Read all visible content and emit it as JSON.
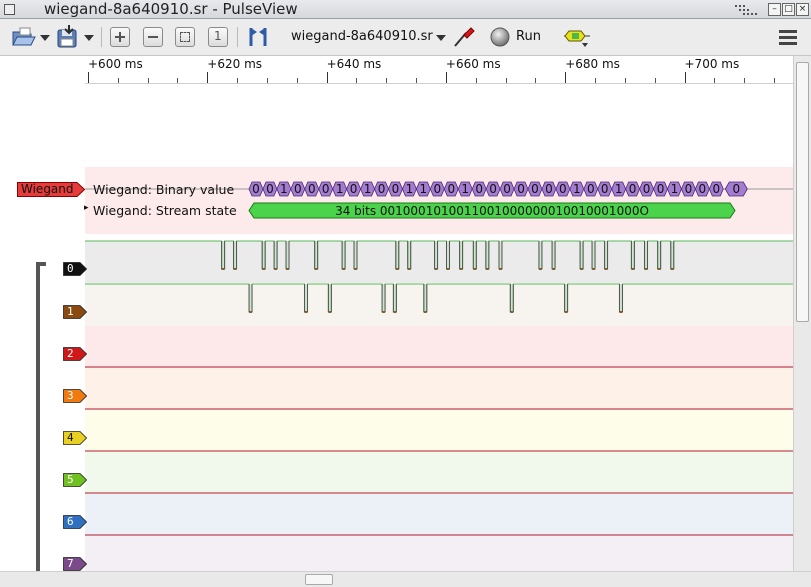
{
  "window": {
    "title": "wiegand-8a640910.sr - PulseView"
  },
  "toolbar": {
    "open_icon": "folder-open-icon",
    "save_icon": "save-icon",
    "zoom_in_icon": "zoom-in-icon",
    "zoom_out_icon": "zoom-out-icon",
    "zoom_fit_icon": "zoom-fit-icon",
    "zoom_one_icon": "zoom-one-to-one-icon",
    "cursor_icon": "cursor-icon",
    "device_name": "wiegand-8a640910.sr",
    "probe_icon": "probe-icon",
    "run_label": "Run",
    "decoder_icon": "add-decoder-icon",
    "menu_icon": "menu-icon"
  },
  "ruler": {
    "ticks": [
      {
        "label": "+600 ms",
        "ms": 600
      },
      {
        "label": "+620 ms",
        "ms": 620
      },
      {
        "label": "+640 ms",
        "ms": 640
      },
      {
        "label": "+660 ms",
        "ms": 660
      },
      {
        "label": "+680 ms",
        "ms": 680
      },
      {
        "label": "+700 ms",
        "ms": 700
      }
    ]
  },
  "decoder": {
    "name": "Wiegand",
    "color": "#e03030",
    "rows": [
      {
        "label": "Wiegand: Binary value",
        "expander": ""
      },
      {
        "label": "Wiegand: Stream state",
        "expander": "▸"
      }
    ],
    "binary_bits": [
      "0",
      "0",
      "1",
      "0",
      "0",
      "0",
      "1",
      "0",
      "1",
      "0",
      "0",
      "1",
      "1",
      "0",
      "0",
      "1",
      "0",
      "0",
      "0",
      "0",
      "0",
      "0",
      "0",
      "1",
      "0",
      "0",
      "1",
      "0",
      "0",
      "0",
      "1",
      "0",
      "0",
      "0"
    ],
    "trailing_bit": "0",
    "stream_state_text": "34 bits 0010001010011001000000010010001000O"
  },
  "channels": [
    {
      "name": "0",
      "color": "#111111",
      "band": "#ebebeb"
    },
    {
      "name": "1",
      "color": "#8a4a10",
      "band": "#f7f3ef"
    },
    {
      "name": "2",
      "color": "#d01818",
      "band": "#fde9e9"
    },
    {
      "name": "3",
      "color": "#f07a10",
      "band": "#fdf1e8"
    },
    {
      "name": "4",
      "color": "#e8d020",
      "band": "#fefde9"
    },
    {
      "name": "5",
      "color": "#70c020",
      "band": "#f1f8ec"
    },
    {
      "name": "6",
      "color": "#3070c0",
      "band": "#ebf1f7"
    },
    {
      "name": "7",
      "color": "#7a4a8a",
      "band": "#f3eff4"
    }
  ],
  "pulses": {
    "ch0_ms": [
      622.4,
      624.4,
      629.2,
      631.2,
      633.2,
      638.0,
      642.6,
      644.6,
      651.6,
      653.6,
      658.1,
      660.1,
      662.3,
      664.6,
      666.7,
      668.9,
      675.6,
      677.8,
      682.5,
      684.5,
      686.6,
      691.1,
      693.3,
      695.5,
      697.7
    ],
    "ch1_ms": [
      627.0,
      636.3,
      640.3,
      649.3,
      651.2,
      656.3,
      670.8,
      679.9,
      689.1
    ],
    "pulse_width_ms": 0.5
  }
}
